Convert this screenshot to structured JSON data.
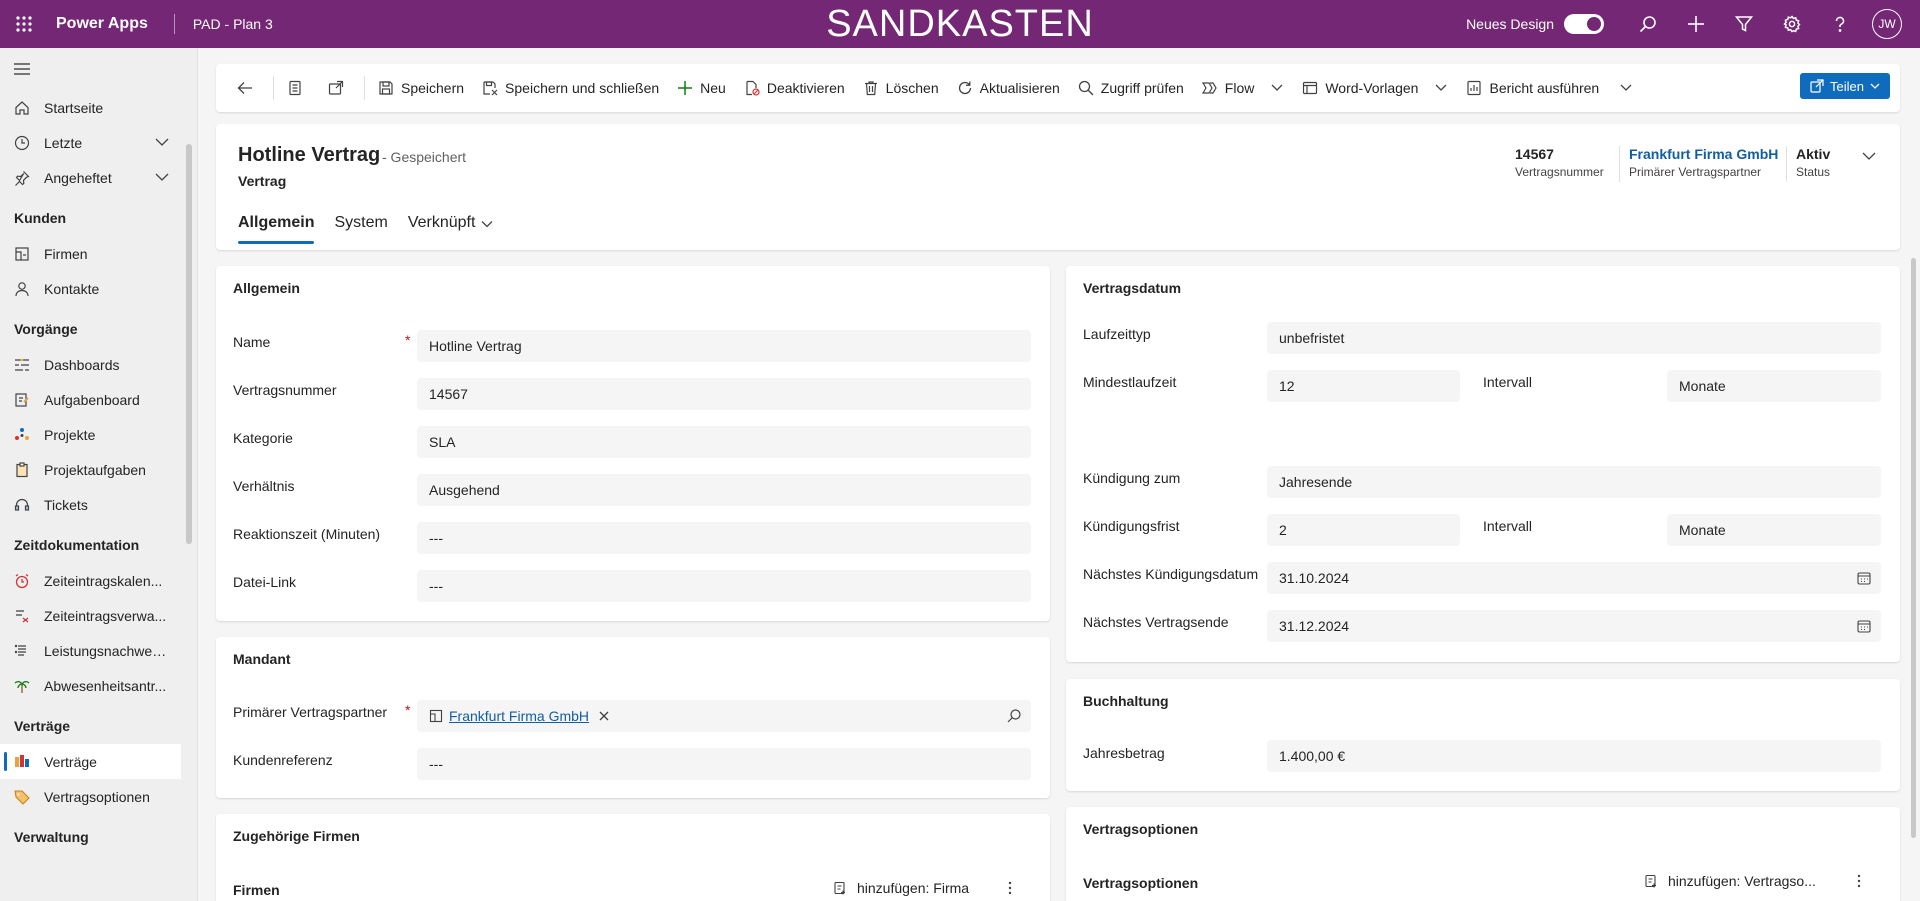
{
  "topbar": {
    "app_name": "Power Apps",
    "environment": "PAD - Plan 3",
    "banner": "SANDKASTEN",
    "new_design_label": "Neues Design",
    "new_design_enabled": true,
    "avatar_initials": "JW",
    "brand_color": "#742774"
  },
  "sidebar": {
    "top_items": [
      {
        "label": "Startseite",
        "icon": "home-icon"
      },
      {
        "label": "Letzte",
        "icon": "clock-icon",
        "expandable": true
      },
      {
        "label": "Angeheftet",
        "icon": "pin-icon",
        "expandable": true
      }
    ],
    "groups": [
      {
        "title": "Kunden",
        "items": [
          {
            "label": "Firmen",
            "icon": "building-icon"
          },
          {
            "label": "Kontakte",
            "icon": "person-icon"
          }
        ]
      },
      {
        "title": "Vorgänge",
        "items": [
          {
            "label": "Dashboards",
            "icon": "dashboard-icon"
          },
          {
            "label": "Aufgabenboard",
            "icon": "taskboard-icon"
          },
          {
            "label": "Projekte",
            "icon": "project-icon"
          },
          {
            "label": "Projektaufgaben",
            "icon": "clipboard-icon"
          },
          {
            "label": "Tickets",
            "icon": "headset-icon"
          }
        ]
      },
      {
        "title": "Zeitdokumentation",
        "items": [
          {
            "label": "Zeiteintragskalen...",
            "icon": "alarm-icon"
          },
          {
            "label": "Zeiteintragsverwa...",
            "icon": "time-manage-icon"
          },
          {
            "label": "Leistungsnachweise",
            "icon": "document-list-icon"
          },
          {
            "label": "Abwesenheitsantr...",
            "icon": "palm-tree-icon"
          }
        ]
      },
      {
        "title": "Verträge",
        "items": [
          {
            "label": "Verträge",
            "icon": "contract-icon",
            "active": true
          },
          {
            "label": "Vertragsoptionen",
            "icon": "tag-icon"
          }
        ]
      },
      {
        "title": "Verwaltung",
        "items": []
      }
    ]
  },
  "commandbar": {
    "save": "Speichern",
    "save_close": "Speichern und schließen",
    "new": "Neu",
    "deactivate": "Deaktivieren",
    "delete": "Löschen",
    "refresh": "Aktualisieren",
    "check_access": "Zugriff prüfen",
    "flow": "Flow",
    "word_templates": "Word-Vorlagen",
    "run_report": "Bericht ausführen",
    "share": "Teilen"
  },
  "header": {
    "title": "Hotline Vertrag",
    "saved_state": "- Gespeichert",
    "entity": "Vertrag",
    "fields": [
      {
        "value": "14567",
        "label": "Vertragsnummer"
      },
      {
        "value": "Frankfurt Firma GmbH",
        "label": "Primärer Vertragspartner",
        "link": true
      },
      {
        "value": "Aktiv",
        "label": "Status"
      }
    ],
    "tabs": [
      "Allgemein",
      "System",
      "Verknüpft"
    ]
  },
  "allgemein": {
    "title": "Allgemein",
    "fields": [
      {
        "label": "Name",
        "value": "Hotline Vertrag",
        "required": true
      },
      {
        "label": "Vertragsnummer",
        "value": "14567"
      },
      {
        "label": "Kategorie",
        "value": "SLA"
      },
      {
        "label": "Verhältnis",
        "value": "Ausgehend"
      },
      {
        "label": "Reaktionszeit (Minuten)",
        "value": "---"
      },
      {
        "label": "Datei-Link",
        "value": "---"
      }
    ]
  },
  "mandant": {
    "title": "Mandant",
    "primary_partner_label": "Primärer Vertragspartner",
    "primary_partner_value": "Frankfurt Firma GmbH",
    "customer_ref_label": "Kundenreferenz",
    "customer_ref_value": "---"
  },
  "zugehoerige": {
    "title": "Zugehörige Firmen",
    "subgrid_title": "Firmen",
    "add_label": "hinzufügen: Firma"
  },
  "vertragsdatum": {
    "title": "Vertragsdatum",
    "laufzeittyp_label": "Laufzeittyp",
    "laufzeittyp_value": "unbefristet",
    "mindest_label": "Mindestlaufzeit",
    "mindest_value": "12",
    "intervall_label": "Intervall",
    "intervall1_value": "Monate",
    "kuendigung_zum_label": "Kündigung zum",
    "kuendigung_zum_value": "Jahresende",
    "frist_label": "Kündigungsfrist",
    "frist_value": "2",
    "intervall2_value": "Monate",
    "next_kuend_label": "Nächstes Kündigungsdatum",
    "next_kuend_value": "31.10.2024",
    "next_end_label": "Nächstes Vertragsende",
    "next_end_value": "31.12.2024"
  },
  "buchhaltung": {
    "title": "Buchhaltung",
    "jahresbetrag_label": "Jahresbetrag",
    "jahresbetrag_value": "1.400,00 €"
  },
  "vertragsoptionen": {
    "title": "Vertragsoptionen",
    "subgrid_title": "Vertragsoptionen",
    "add_label": "hinzufügen: Vertragso..."
  }
}
